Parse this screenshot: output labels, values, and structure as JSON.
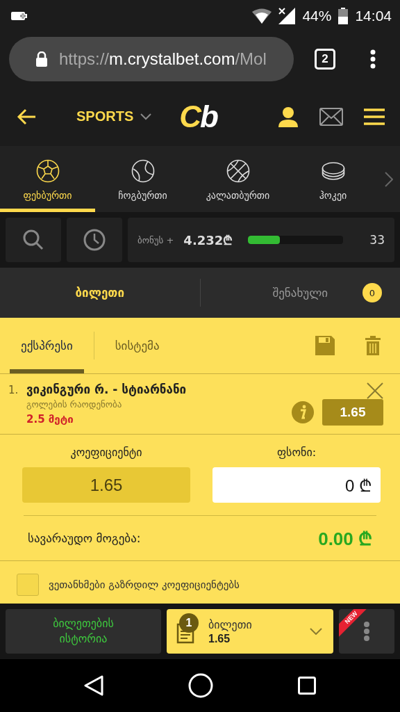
{
  "status_bar": {
    "battery": "44%",
    "time": "14:04"
  },
  "browser": {
    "url_scheme": "https://",
    "url_host": "m.crystalbet.com",
    "url_path": "/Mol",
    "tab_count": "2"
  },
  "header": {
    "sport_menu": "SPORTS",
    "logo_first": "C",
    "logo_second": "b"
  },
  "sports": [
    {
      "label": "ფეხბურთი",
      "kind": "soccer",
      "selected": true
    },
    {
      "label": "ჩოგბურთი",
      "kind": "tennis",
      "selected": false
    },
    {
      "label": "კალათბურთი",
      "kind": "basketball",
      "selected": false
    },
    {
      "label": "ჰოკეი",
      "kind": "hockey",
      "selected": false
    }
  ],
  "bonus": {
    "label": "ბონუს +",
    "amount": "4.232₾",
    "level": 0.33,
    "count": "33"
  },
  "slip_tabs": [
    {
      "label": "ბილეთი",
      "selected": true
    },
    {
      "label": "შენახული",
      "selected": false,
      "count": "0"
    }
  ],
  "bet_types": [
    {
      "label": "ექსპრესი",
      "selected": true
    },
    {
      "label": "სისტემა",
      "selected": false
    }
  ],
  "selections": [
    {
      "number": "1.",
      "event": "ვიკინგური რ. - სტიარნანი",
      "market": "გოლების რაოდენობა",
      "outcome": "2.5 მეტი",
      "odds": "1.65"
    }
  ],
  "summary": {
    "odds_label": "კოეფიციენტი",
    "odds": "1.65",
    "stake_label": "ფსონი:",
    "stake": "0 ₾",
    "win_label": "სავარაუდო მოგება:",
    "win": "0.00 ₾"
  },
  "accept_odds": {
    "label": "ვეთანხმები გაზრდილ კოეფიციენტებს",
    "checked": false
  },
  "bottom_bar": {
    "history": "ბილეთების ისტორია",
    "slip_count": "1",
    "slip_label": "ბილეთი",
    "slip_odds": "1.65",
    "new_badge": "NEW"
  }
}
